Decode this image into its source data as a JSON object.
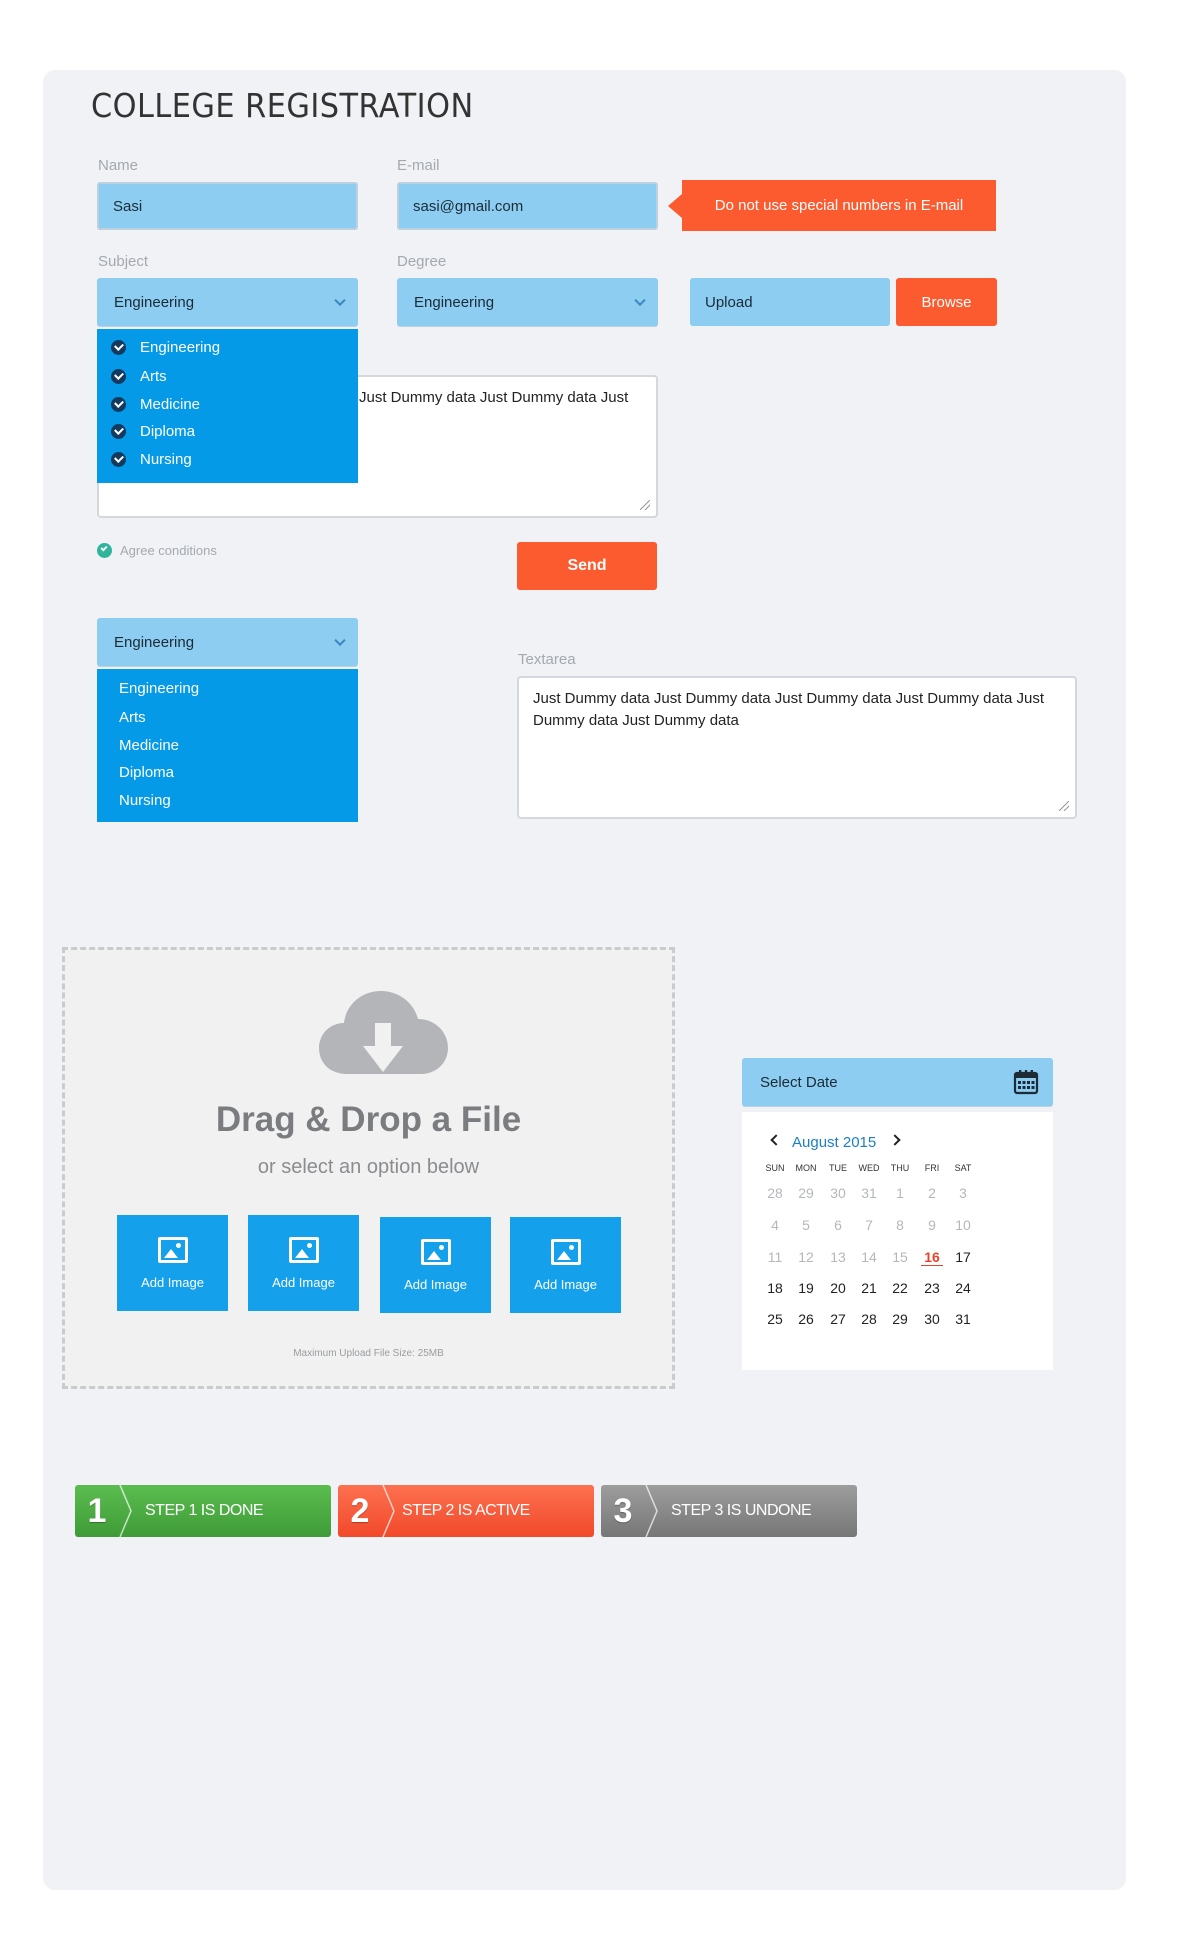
{
  "page": {
    "title": "COLLEGE REGISTRATION"
  },
  "form": {
    "name_label": "Name",
    "name_value": "Sasi",
    "email_label": "E-mail",
    "email_value": "sasi@gmail.com",
    "email_error": "Do not use special numbers in E-mail",
    "subject_label": "Subject",
    "subject_value": "Engineering",
    "degree_label": "Degree",
    "degree_value": "Engineering",
    "upload_label": "Upload",
    "browse_label": "Browse",
    "subject_options": [
      "Engineering",
      "Arts",
      "Medicine",
      "Diploma",
      "Nursing"
    ],
    "textarea1_visible": "Just Dummy data Just Dummy data Just",
    "agree_label": "Agree conditions",
    "send_label": "Send"
  },
  "second_dropdown": {
    "value": "Engineering",
    "options": [
      "Engineering",
      "Arts",
      "Medicine",
      "Diploma",
      "Nursing"
    ]
  },
  "textarea2": {
    "label": "Textarea",
    "value": "Just Dummy data Just Dummy data Just Dummy data Just Dummy data Just Dummy data Just Dummy data"
  },
  "dropzone": {
    "heading": "Drag & Drop a File",
    "subheading": "or select an option below",
    "buttons": [
      "Add Image",
      "Add Image",
      "Add Image",
      "Add Image"
    ],
    "note": "Maximum Upload File Size: 25MB"
  },
  "datepicker": {
    "placeholder": "Select Date",
    "month": "August 2015",
    "weekdays": [
      "SUN",
      "MON",
      "TUE",
      "WED",
      "THU",
      "FRI",
      "SAT"
    ],
    "weeks": [
      [
        "28",
        "29",
        "30",
        "31",
        "1",
        "2",
        "3"
      ],
      [
        "4",
        "5",
        "6",
        "7",
        "8",
        "9",
        "10"
      ],
      [
        "11",
        "12",
        "13",
        "14",
        "15",
        "16",
        "17"
      ],
      [
        "18",
        "19",
        "20",
        "21",
        "22",
        "23",
        "24"
      ],
      [
        "25",
        "26",
        "27",
        "28",
        "29",
        "30",
        "31"
      ]
    ],
    "selected": "16",
    "colors": {
      "muted": "#b4b8bd",
      "active": "#222222",
      "today": "#e8412c",
      "accent": "#1b7fc4"
    }
  },
  "steps": [
    {
      "number": "1",
      "label": "STEP 1 IS DONE",
      "color": "#4fae45"
    },
    {
      "number": "2",
      "label": "STEP 2 IS ACTIVE",
      "color": "#fb5e3c"
    },
    {
      "number": "3",
      "label": "STEP 3 IS UNDONE",
      "color": "#8a8a8a"
    }
  ],
  "icons": {
    "dropdown": "chevron-down-icon",
    "checkbox": "check-circle-icon",
    "cloud": "cloud-download-icon",
    "image": "image-icon",
    "calendar": "calendar-icon",
    "prev": "chevron-left-icon",
    "next": "chevron-right-icon"
  }
}
